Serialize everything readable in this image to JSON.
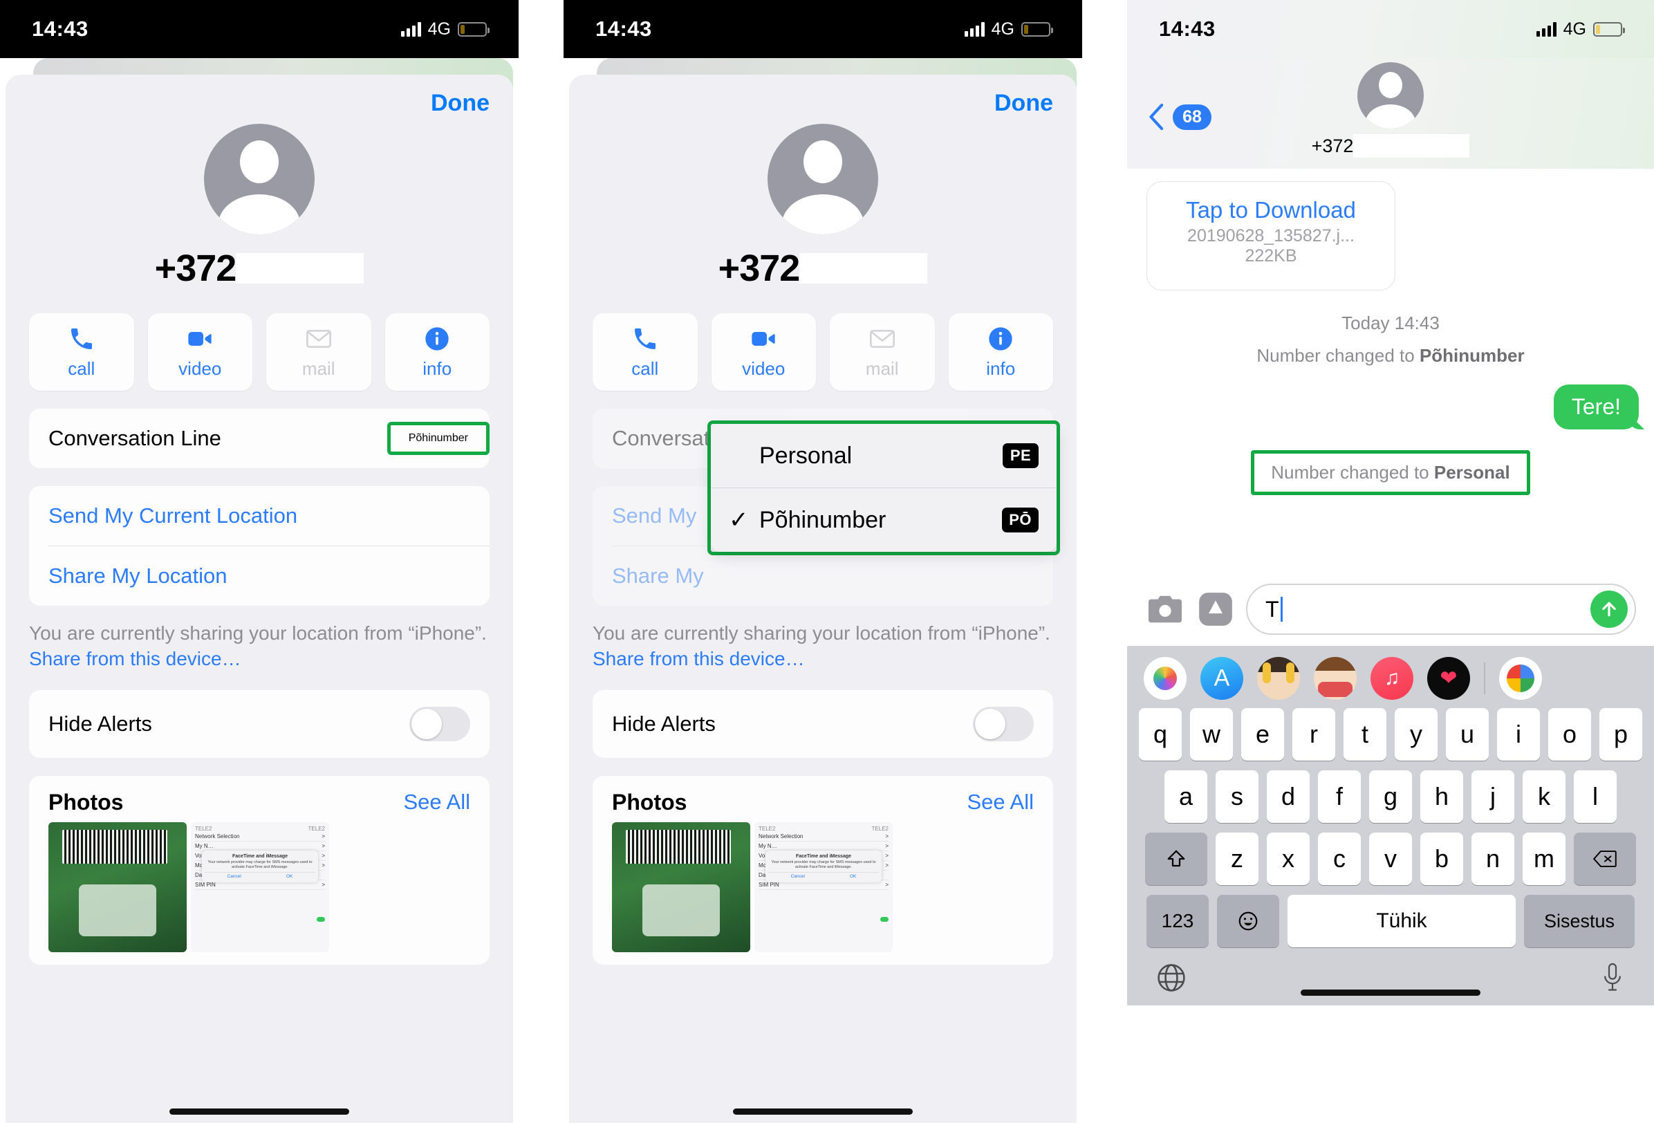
{
  "status_bar": {
    "time": "14:43",
    "network": "4G",
    "signal_icon": "signal-bars-icon",
    "battery_icon": "battery-icon"
  },
  "panel1": {
    "done_label": "Done",
    "avatar_icon": "contact-avatar-icon",
    "phone_number": "+372",
    "redacted": "",
    "actions": [
      {
        "label": "call",
        "icon": "phone-icon",
        "enabled": true
      },
      {
        "label": "video",
        "icon": "video-camera-icon",
        "enabled": true
      },
      {
        "label": "mail",
        "icon": "envelope-icon",
        "enabled": false
      },
      {
        "label": "info",
        "icon": "info-circle-icon",
        "enabled": true
      }
    ],
    "conversation_line": {
      "label": "Conversation Line",
      "value": "Põhinumber",
      "highlighted": true
    },
    "location": {
      "send_current": "Send My Current Location",
      "share": "Share My Location",
      "note_prefix": "You are currently sharing your location from “iPhone”. ",
      "note_link": "Share from this device…"
    },
    "hide_alerts": {
      "label": "Hide Alerts",
      "on": false
    },
    "photos": {
      "title": "Photos",
      "see_all": "See All"
    }
  },
  "panel2": {
    "done_label": "Done",
    "phone_number": "+372",
    "conversation_line": {
      "label": "Conversation Line",
      "value": "Põhinumber"
    },
    "dropdown": {
      "highlighted": true,
      "items": [
        {
          "label": "Personal",
          "badge": "PE",
          "checked": false
        },
        {
          "label": "Põhinumber",
          "badge": "PŌ",
          "checked": true
        }
      ]
    },
    "location": {
      "send_current": "Send My",
      "share": "Share My",
      "note_prefix": "You are currently sharing your location from “iPhone”. ",
      "note_link": "Share from this device…"
    },
    "hide_alerts": {
      "label": "Hide Alerts",
      "on": false
    },
    "photos": {
      "title": "Photos",
      "see_all": "See All"
    }
  },
  "panel3": {
    "back_badge": "68",
    "back_icon": "chevron-left-icon",
    "contact_number": "+372",
    "messages": [
      {
        "type": "attachment",
        "action": "Tap to Download",
        "filename": "20190628_135827.j...",
        "size": "222KB"
      },
      {
        "type": "timestamp",
        "text": "Today 14:43"
      },
      {
        "type": "system",
        "prefix": "Number changed to ",
        "value": "Põhinumber"
      },
      {
        "type": "outgoing",
        "text": "Tere!"
      },
      {
        "type": "system",
        "prefix": "Number changed to ",
        "value": "Personal",
        "highlighted": true
      }
    ],
    "composer": {
      "camera_icon": "camera-icon",
      "appstore_icon": "app-store-icon",
      "typed_text": "T",
      "send_icon": "send-arrow-up-icon"
    },
    "keyboard": {
      "app_rail": [
        "photos-app-icon",
        "app-store-icon",
        "memoji-icon-1",
        "memoji-icon-2",
        "apple-music-icon",
        "fitness-icon",
        "maps-icon"
      ],
      "rows": [
        [
          "q",
          "w",
          "e",
          "r",
          "t",
          "y",
          "u",
          "i",
          "o",
          "p"
        ],
        [
          "a",
          "s",
          "d",
          "f",
          "g",
          "h",
          "j",
          "k",
          "l"
        ],
        [
          "z",
          "x",
          "c",
          "v",
          "b",
          "n",
          "m"
        ]
      ],
      "shift_icon": "shift-up-icon",
      "backspace_icon": "backspace-icon",
      "numbers_key": "123",
      "emoji_icon": "emoji-smiley-icon",
      "space_key": "Tühik",
      "enter_key": "Sisestus",
      "globe_icon": "globe-icon",
      "mic_icon": "microphone-icon"
    }
  },
  "colors": {
    "accent_blue": "#2b7cf6",
    "highlight_green": "#12a844",
    "bubble_green": "#34c759"
  }
}
